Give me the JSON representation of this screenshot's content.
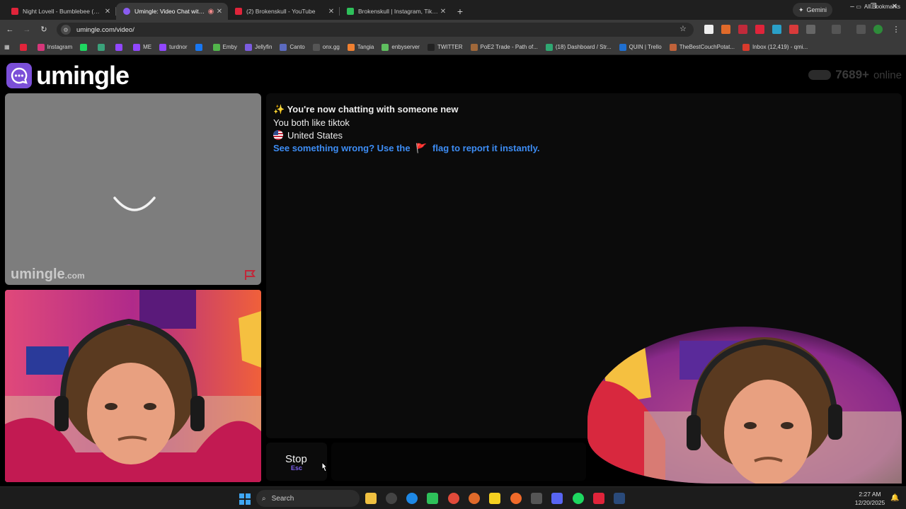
{
  "browser": {
    "tabs": [
      {
        "title": "Night Lovell - Bumblebee (KEFI",
        "favicon_color": "#e0243a",
        "active": false
      },
      {
        "title": "Umingle: Video Chat with S",
        "favicon_color": "#8a5cf0",
        "active": true
      },
      {
        "title": "(2) Brokenskull - YouTube",
        "favicon_color": "#e0243a",
        "active": false
      },
      {
        "title": "Brokenskull | Instagram, TikTok,",
        "favicon_color": "#2ec05a",
        "active": false
      }
    ],
    "new_tab": "+",
    "gemini_label": "Gemini",
    "window_controls": {
      "minimize": "–",
      "restore": "❐",
      "close": "✕"
    },
    "url": "umingle.com/video/",
    "bookmarks": [
      {
        "label": "",
        "color": "#e0243a"
      },
      {
        "label": "Instagram",
        "color": "#d6367a"
      },
      {
        "label": "",
        "color": "#1ed760"
      },
      {
        "label": "",
        "color": "#3aa27a"
      },
      {
        "label": "",
        "color": "#9147ff"
      },
      {
        "label": "ME",
        "color": "#9147ff"
      },
      {
        "label": "turdnor",
        "color": "#9147ff"
      },
      {
        "label": "",
        "color": "#1877f2"
      },
      {
        "label": "Emby",
        "color": "#52b54b"
      },
      {
        "label": "Jellyfin",
        "color": "#7b5ce0"
      },
      {
        "label": "Canto",
        "color": "#5c6bc0"
      },
      {
        "label": "onx.gg",
        "color": "#555555"
      },
      {
        "label": "Tangia",
        "color": "#f08030"
      },
      {
        "label": "enbyserver",
        "color": "#5fbf5f"
      },
      {
        "label": "TWITTER",
        "color": "#222222"
      },
      {
        "label": "PoE2 Trade - Path of...",
        "color": "#a0683a"
      },
      {
        "label": "(18) Dashboard / Str...",
        "color": "#2fa872"
      },
      {
        "label": "QUIN | Trello",
        "color": "#1f6fd0"
      },
      {
        "label": "TheBestCouchPotat...",
        "color": "#c0623a"
      },
      {
        "label": "Inbox (12,419) - qmi...",
        "color": "#d93a2c"
      }
    ],
    "all_bookmarks_label": "All Bookmarks"
  },
  "page": {
    "logo_text": "umingle",
    "online_count": "7689+",
    "online_label": "online",
    "watermark": "umingle",
    "watermark_suffix": ".com",
    "chat": {
      "line1_icon": "✨",
      "line1": "You're now chatting with someone new",
      "line2": "You both like tiktok",
      "line3": "United States",
      "line4_before": "See something wrong? Use the",
      "line4_flag": "🚩",
      "line4_after": "flag to report it instantly."
    },
    "stop_label": "Stop",
    "stop_shortcut": "Esc",
    "message_placeholder": ""
  },
  "taskbar": {
    "search_label": "Search",
    "time": "2:27 AM",
    "date": "12/20/2025"
  },
  "colors": {
    "brand": "#7b4fd8",
    "link": "#3d8df5",
    "flag_red": "#c0283a"
  }
}
